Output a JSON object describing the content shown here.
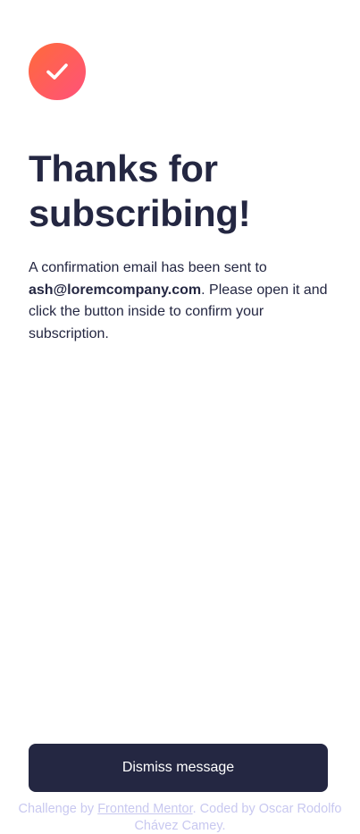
{
  "icons": {
    "success": "check-icon"
  },
  "colors": {
    "badge_gradient_start": "#ff6a3a",
    "badge_gradient_end": "#ff527b",
    "dark_navy": "#242742",
    "attribution_text": "#c8c8f0"
  },
  "main": {
    "title": "Thanks for subscribing!",
    "message_before": "A confirmation email has been sent to ",
    "email": "ash@loremcompany.com",
    "message_after": ". Please open it and click the button inside to confirm your subscription."
  },
  "actions": {
    "dismiss_label": "Dismiss message"
  },
  "footer": {
    "challenge_by": "Challenge by ",
    "frontend_mentor_link": "Frontend Mentor",
    "coded_by": ". Coded by Oscar Rodolfo Chávez Camey."
  }
}
